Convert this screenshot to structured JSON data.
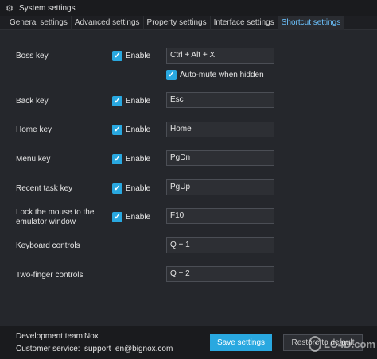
{
  "window": {
    "title": "System settings",
    "icon": "gear-icon"
  },
  "tabs": [
    {
      "label": "General settings",
      "active": false
    },
    {
      "label": "Advanced settings",
      "active": false
    },
    {
      "label": "Property settings",
      "active": false
    },
    {
      "label": "Interface settings",
      "active": false
    },
    {
      "label": "Shortcut settings",
      "active": true
    }
  ],
  "enable_label": "Enable",
  "rows": {
    "boss": {
      "label": "Boss key",
      "enabled": true,
      "shortcut": "Ctrl + Alt + X"
    },
    "auto_mute": {
      "label": "Auto-mute when hidden",
      "checked": true
    },
    "back": {
      "label": "Back key",
      "enabled": true,
      "shortcut": "Esc"
    },
    "home": {
      "label": "Home key",
      "enabled": true,
      "shortcut": "Home"
    },
    "menu": {
      "label": "Menu key",
      "enabled": true,
      "shortcut": "PgDn"
    },
    "recent": {
      "label": "Recent task key",
      "enabled": true,
      "shortcut": "PgUp"
    },
    "lock": {
      "label_line1": "Lock the mouse to the",
      "label_line2": "emulator window",
      "enabled": true,
      "shortcut": "F10"
    },
    "keyboard": {
      "label": "Keyboard controls",
      "shortcut": "Q + 1"
    },
    "two_finger": {
      "label": "Two-finger controls",
      "shortcut": "Q + 2"
    }
  },
  "footer": {
    "dev_team_label": "Development team:",
    "dev_team_value": "Nox",
    "service_label": "Customer service:",
    "service_value": "support  en@bignox.com",
    "save_label": "Save settings",
    "restore_label": "Restore to default"
  },
  "watermark": {
    "text": "LO4D.com"
  },
  "colors": {
    "accent": "#29a8e0",
    "active_tab_text": "#6cc3ff",
    "background": "#25272c"
  }
}
